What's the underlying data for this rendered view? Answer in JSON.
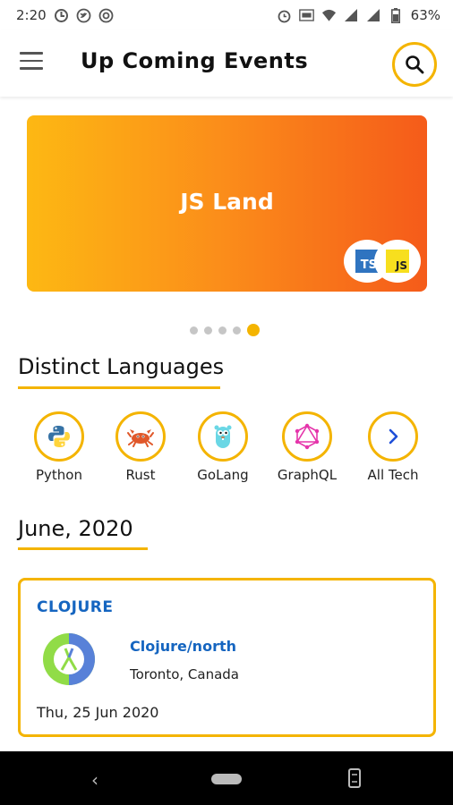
{
  "status_bar": {
    "time": "2:20",
    "battery": "63%",
    "left_icons": [
      "maps-icon",
      "twitter-icon",
      "at-icon"
    ],
    "right_icons": [
      "alarm-icon",
      "volte-icon",
      "wifi-icon",
      "signal-icon",
      "signal-icon",
      "battery-icon"
    ]
  },
  "app_bar": {
    "title": "Up Coming Events",
    "menu_icon": "hamburger-menu-icon",
    "search_icon": "search-icon"
  },
  "banner": {
    "title": "JS Land",
    "badges": [
      {
        "text": "TS",
        "color": "#2f74c0"
      },
      {
        "text": "JS",
        "color": "#f7df1e"
      }
    ],
    "gradient": [
      "#fdb813",
      "#f55b1a"
    ]
  },
  "carousel": {
    "count": 5,
    "active_index": 4
  },
  "languages_section": {
    "title": "Distinct Languages",
    "items": [
      {
        "label": "Python",
        "icon": "python-icon"
      },
      {
        "label": "Rust",
        "icon": "rust-crab-icon"
      },
      {
        "label": "GoLang",
        "icon": "gopher-icon"
      },
      {
        "label": "GraphQL",
        "icon": "graphql-icon"
      },
      {
        "label": "All Tech",
        "icon": "chevron-right-icon"
      }
    ]
  },
  "events_section": {
    "title": "June, 2020",
    "event": {
      "category": "CLOJURE",
      "name": "Clojure/north",
      "location": "Toronto, Canada",
      "date": "Thu, 25 Jun 2020",
      "logo": "clojure-logo-icon"
    }
  },
  "colors": {
    "accent": "#f4b400",
    "link_blue": "#1565c0"
  }
}
